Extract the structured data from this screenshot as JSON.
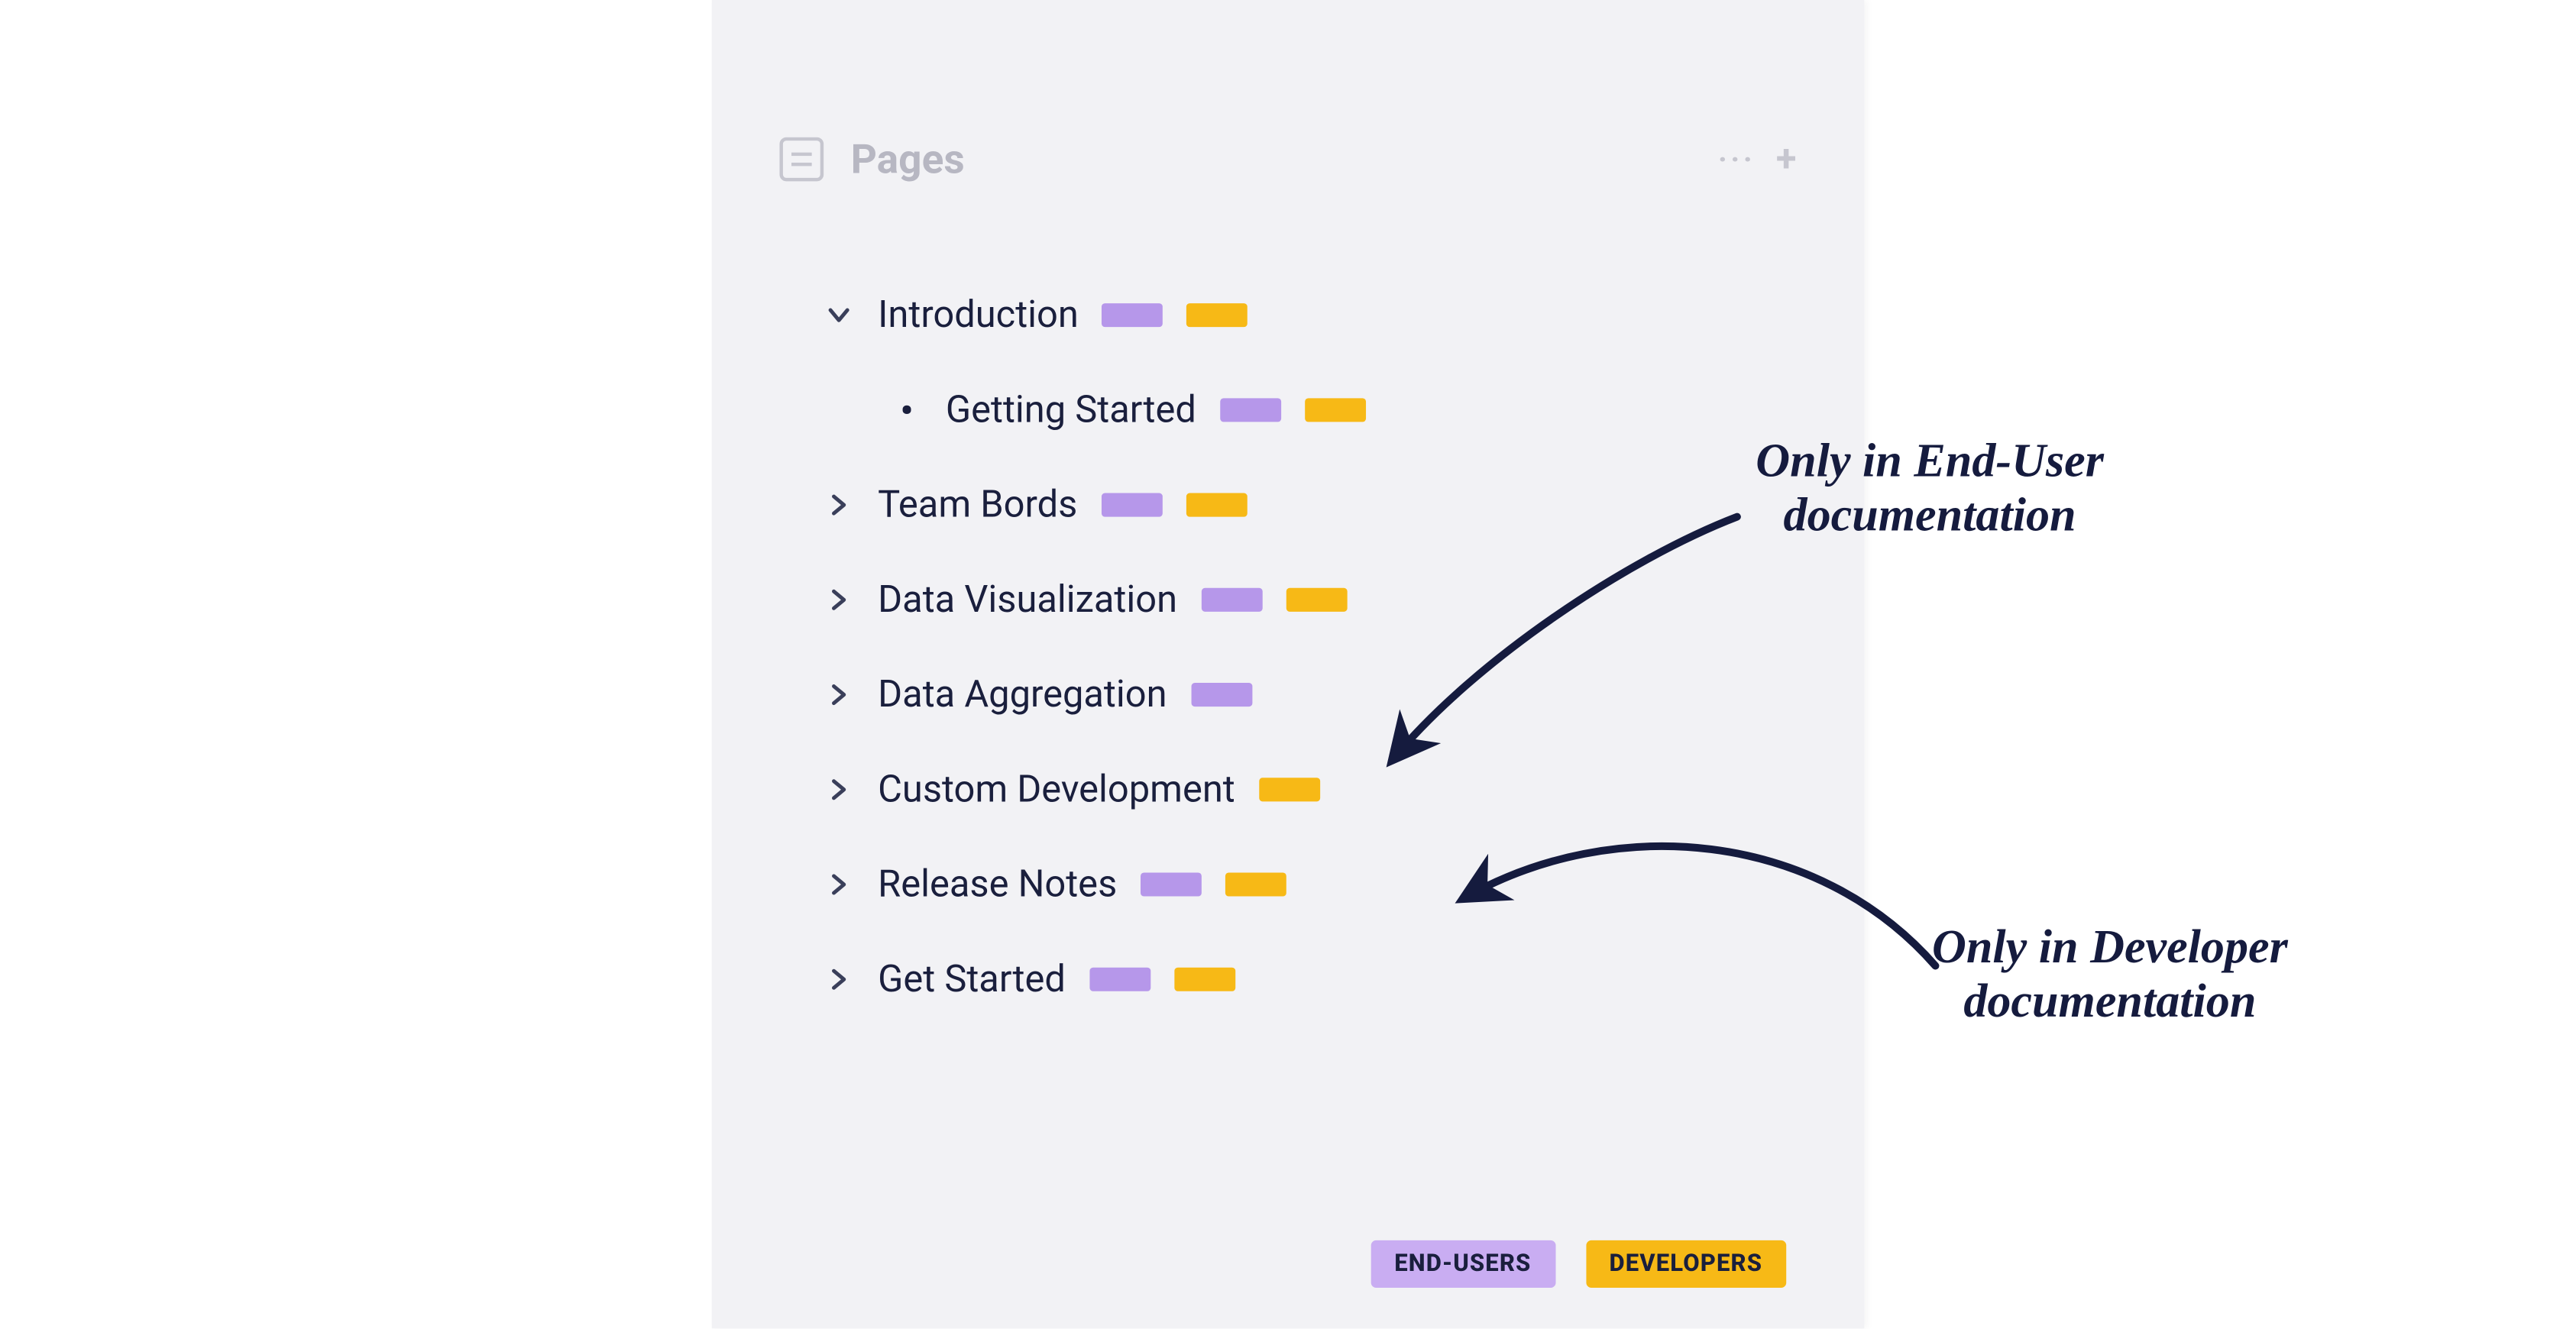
{
  "colors": {
    "purple": "#b697ea",
    "yellow": "#f7b916",
    "ink": "#151b3e"
  },
  "header": {
    "title": "Pages"
  },
  "tree": [
    {
      "label": "Introduction",
      "level": 0,
      "icon": "down",
      "tags": [
        "purple",
        "yellow"
      ]
    },
    {
      "label": "Getting Started",
      "level": 1,
      "icon": "bullet",
      "tags": [
        "purple",
        "yellow"
      ]
    },
    {
      "label": "Team Bords",
      "level": 0,
      "icon": "right",
      "tags": [
        "purple",
        "yellow"
      ]
    },
    {
      "label": "Data Visualization",
      "level": 0,
      "icon": "right",
      "tags": [
        "purple",
        "yellow"
      ]
    },
    {
      "label": "Data Aggregation",
      "level": 0,
      "icon": "right",
      "tags": [
        "purple"
      ]
    },
    {
      "label": "Custom Development",
      "level": 0,
      "icon": "right",
      "tags": [
        "yellow"
      ]
    },
    {
      "label": "Release Notes",
      "level": 0,
      "icon": "right",
      "tags": [
        "purple",
        "yellow"
      ]
    },
    {
      "label": "Get Started",
      "level": 0,
      "icon": "right",
      "tags": [
        "purple",
        "yellow"
      ]
    }
  ],
  "legend": {
    "purple_label": "END-USERS",
    "yellow_label": "DEVELOPERS"
  },
  "annotations": {
    "end_user": "Only in End-User\ndocumentation",
    "developer": "Only in Developer\ndocumentation"
  }
}
